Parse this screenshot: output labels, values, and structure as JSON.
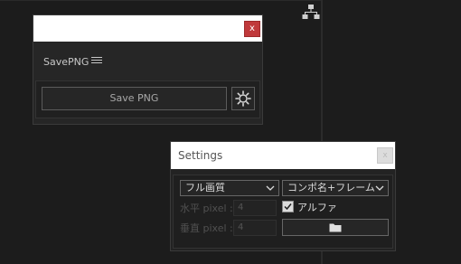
{
  "panel1": {
    "name": "SavePNG",
    "close_label": "x",
    "save_label": "Save PNG",
    "menu_icon": "hamburger-icon",
    "settings_icon": "gear-icon"
  },
  "panel2": {
    "title": "Settings",
    "close_label": "x",
    "quality_select": "フル画質",
    "name_select": "コンポ名+フレーム",
    "h_label": "水平 pixel :",
    "v_label": "垂直 pixel :",
    "h_value": "4",
    "v_value": "4",
    "alpha_label": "アルファ",
    "alpha_checked": true,
    "folder_icon": "folder-icon"
  },
  "colors": {
    "close_red": "#c0393b",
    "background": "#1c1c1c"
  }
}
